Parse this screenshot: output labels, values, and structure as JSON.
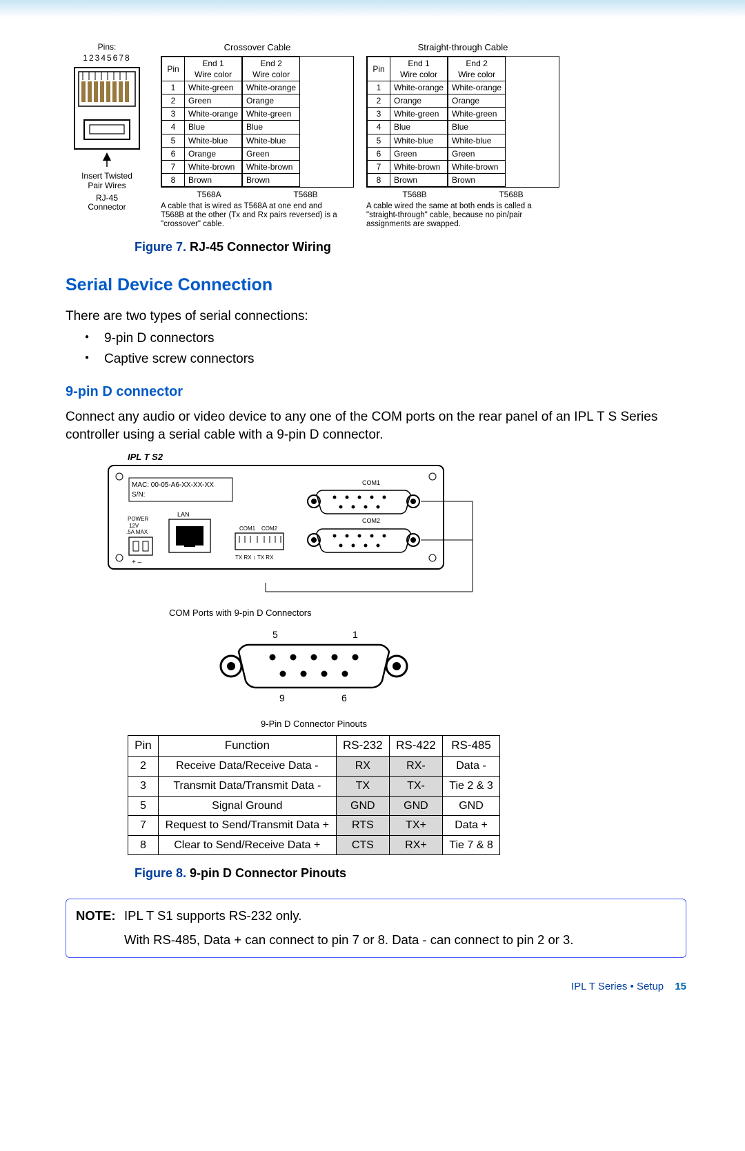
{
  "rj45": {
    "pins_label": "Pins:",
    "pins_text": "12345678",
    "insert_text": "Insert Twisted\nPair Wires",
    "connector_label": "RJ-45\nConnector"
  },
  "crossover": {
    "title": "Crossover Cable",
    "end1": "End 1\nWire color",
    "end2": "End 2\nWire color",
    "pin_hdr": "Pin",
    "rows": [
      {
        "pin": "1",
        "c1": "White-green",
        "c2": "White-orange"
      },
      {
        "pin": "2",
        "c1": "Green",
        "c2": "Orange"
      },
      {
        "pin": "3",
        "c1": "White-orange",
        "c2": "White-green"
      },
      {
        "pin": "4",
        "c1": "Blue",
        "c2": "Blue"
      },
      {
        "pin": "5",
        "c1": "White-blue",
        "c2": "White-blue"
      },
      {
        "pin": "6",
        "c1": "Orange",
        "c2": "Green"
      },
      {
        "pin": "7",
        "c1": "White-brown",
        "c2": "White-brown"
      },
      {
        "pin": "8",
        "c1": "Brown",
        "c2": "Brown"
      }
    ],
    "std1": "T568A",
    "std2": "T568B",
    "foot": "A cable that is wired as T568A at one end and T568B at the other (Tx and Rx pairs reversed) is a \"crossover\" cable."
  },
  "straight": {
    "title": "Straight-through Cable",
    "end1": "End 1\nWire color",
    "end2": "End 2\nWire color",
    "pin_hdr": "Pin",
    "rows": [
      {
        "pin": "1",
        "c1": "White-orange",
        "c2": "White-orange"
      },
      {
        "pin": "2",
        "c1": "Orange",
        "c2": "Orange"
      },
      {
        "pin": "3",
        "c1": "White-green",
        "c2": "White-green"
      },
      {
        "pin": "4",
        "c1": "Blue",
        "c2": "Blue"
      },
      {
        "pin": "5",
        "c1": "White-blue",
        "c2": "White-blue"
      },
      {
        "pin": "6",
        "c1": "Green",
        "c2": "Green"
      },
      {
        "pin": "7",
        "c1": "White-brown",
        "c2": "White-brown"
      },
      {
        "pin": "8",
        "c1": "Brown",
        "c2": "Brown"
      }
    ],
    "std1": "T568B",
    "std2": "T568B",
    "foot": "A cable wired the same at both ends is called a \"straight-through\" cable, because no pin/pair assignments are swapped."
  },
  "fig7": {
    "label": "Figure 7.",
    "text": " RJ-45 Connector Wiring"
  },
  "section": {
    "h1": "Serial Device Connection",
    "intro": "There are two types of serial connections:",
    "b1": "9-pin D connectors",
    "b2": "Captive screw connectors"
  },
  "h2": "9-pin D connector",
  "para": "Connect any audio or video device to any one of the COM ports on the rear panel of an IPL T S Series controller using a serial cable with a 9-pin D connector.",
  "device": {
    "model": "IPL T S2",
    "mac": "MAC: 00-05-A6-XX-XX-XX",
    "sn": "S/N:",
    "power": "POWER",
    "v": "12V",
    "a": ".5A MAX",
    "lan": "LAN",
    "com1s": "COM1",
    "com2s": "COM2",
    "txrx": "TX RX",
    "com1": "COM1",
    "com2": "COM2",
    "caption": "COM Ports with 9-pin D Connectors"
  },
  "dconn": {
    "t5": "5",
    "t1": "1",
    "b9": "9",
    "b6": "6",
    "caption": "9-Pin D Connector Pinouts"
  },
  "pinout": {
    "hdr": {
      "pin": "Pin",
      "func": "Function",
      "rs232": "RS-232",
      "rs422": "RS-422",
      "rs485": "RS-485"
    },
    "rows": [
      {
        "pin": "2",
        "func": "Receive Data/Receive Data -",
        "rs232": "RX",
        "rs422": "RX-",
        "rs485": "Data -"
      },
      {
        "pin": "3",
        "func": "Transmit Data/Transmit Data -",
        "rs232": "TX",
        "rs422": "TX-",
        "rs485": "Tie 2 & 3"
      },
      {
        "pin": "5",
        "func": "Signal Ground",
        "rs232": "GND",
        "rs422": "GND",
        "rs485": "GND"
      },
      {
        "pin": "7",
        "func": "Request to Send/Transmit Data +",
        "rs232": "RTS",
        "rs422": "TX+",
        "rs485": "Data +"
      },
      {
        "pin": "8",
        "func": "Clear to Send/Receive Data +",
        "rs232": "CTS",
        "rs422": "RX+",
        "rs485": "Tie 7 & 8"
      }
    ]
  },
  "fig8": {
    "label": "Figure 8.",
    "text": " 9-pin D Connector Pinouts"
  },
  "note": {
    "label": "NOTE:",
    "l1": "IPL T S1 supports RS-232 only.",
    "l2": "With RS-485, Data + can connect to pin 7 or 8. Data - can connect to pin 2 or 3."
  },
  "footer": {
    "section": "IPL T Series • Setup",
    "page": "15"
  }
}
